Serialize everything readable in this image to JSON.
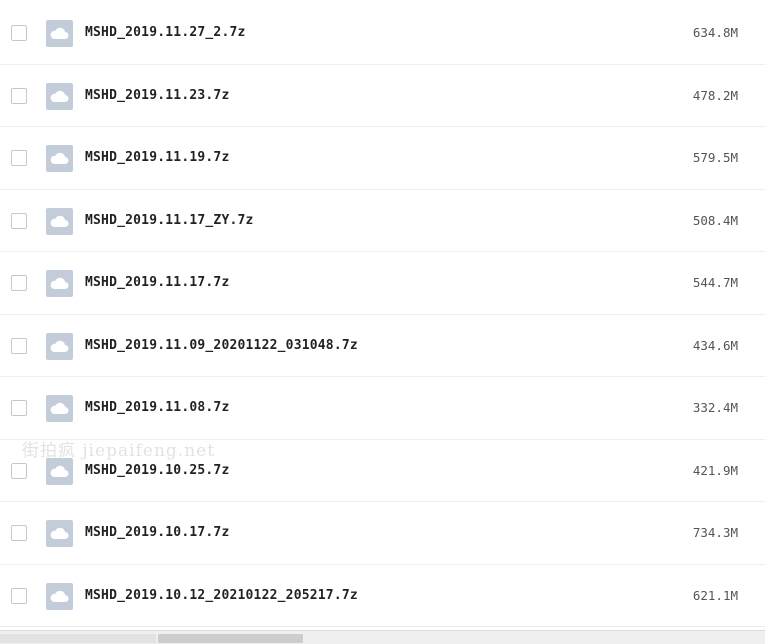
{
  "files": [
    {
      "name": "MSHD_2019.11.27_2.7z",
      "size": "634.8M",
      "icon": "cloud-file-icon"
    },
    {
      "name": "MSHD_2019.11.23.7z",
      "size": "478.2M",
      "icon": "cloud-file-icon"
    },
    {
      "name": "MSHD_2019.11.19.7z",
      "size": "579.5M",
      "icon": "cloud-file-icon"
    },
    {
      "name": "MSHD_2019.11.17_ZY.7z",
      "size": "508.4M",
      "icon": "cloud-file-icon"
    },
    {
      "name": "MSHD_2019.11.17.7z",
      "size": "544.7M",
      "icon": "cloud-file-icon"
    },
    {
      "name": "MSHD_2019.11.09_20201122_031048.7z",
      "size": "434.6M",
      "icon": "cloud-file-icon"
    },
    {
      "name": "MSHD_2019.11.08.7z",
      "size": "332.4M",
      "icon": "cloud-file-icon"
    },
    {
      "name": "MSHD_2019.10.25.7z",
      "size": "421.9M",
      "icon": "cloud-file-icon"
    },
    {
      "name": "MSHD_2019.10.17.7z",
      "size": "734.3M",
      "icon": "cloud-file-icon"
    },
    {
      "name": "MSHD_2019.10.12_20210122_205217.7z",
      "size": "621.1M",
      "icon": "cloud-file-icon"
    }
  ],
  "watermark": "街拍疯  jiepaifeng.net",
  "colors": {
    "icon_bg": "#c3cdd9",
    "row_divider": "#eeeeee",
    "text": "#222222",
    "size_text": "#555555"
  }
}
